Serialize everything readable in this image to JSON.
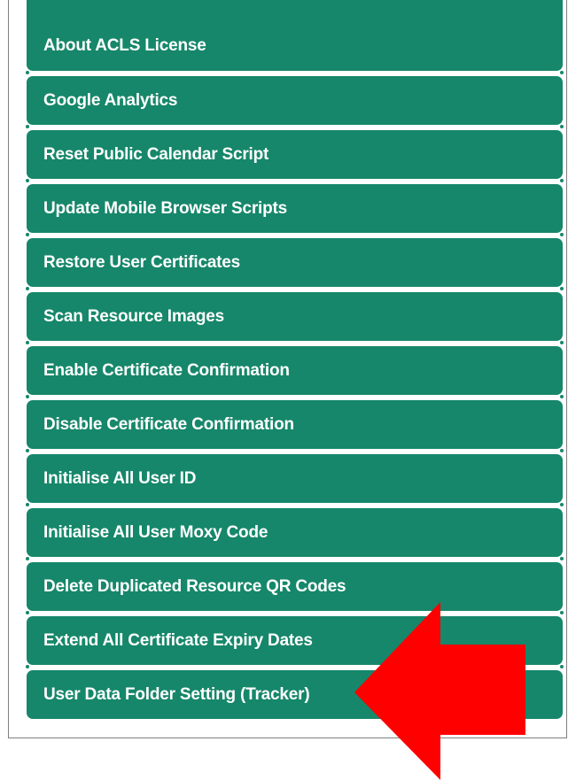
{
  "menu": {
    "items": [
      {
        "label": "About ACLS License"
      },
      {
        "label": "Google Analytics"
      },
      {
        "label": "Reset Public Calendar Script"
      },
      {
        "label": "Update Mobile Browser Scripts"
      },
      {
        "label": "Restore User Certificates"
      },
      {
        "label": "Scan Resource Images"
      },
      {
        "label": "Enable Certificate Confirmation"
      },
      {
        "label": "Disable Certificate Confirmation"
      },
      {
        "label": "Initialise All User ID"
      },
      {
        "label": "Initialise All User Moxy Code"
      },
      {
        "label": "Delete Duplicated Resource QR Codes"
      },
      {
        "label": "Extend All Certificate Expiry Dates"
      },
      {
        "label": "User Data Folder Setting (Tracker)"
      }
    ]
  },
  "colors": {
    "menu_background": "#16876a",
    "menu_text": "#ffffff",
    "arrow": "#ff0000",
    "panel_border": "#7f7f7f"
  },
  "annotation": {
    "icon": "arrow-left-icon",
    "points_to": "User Data Folder Setting (Tracker)"
  }
}
